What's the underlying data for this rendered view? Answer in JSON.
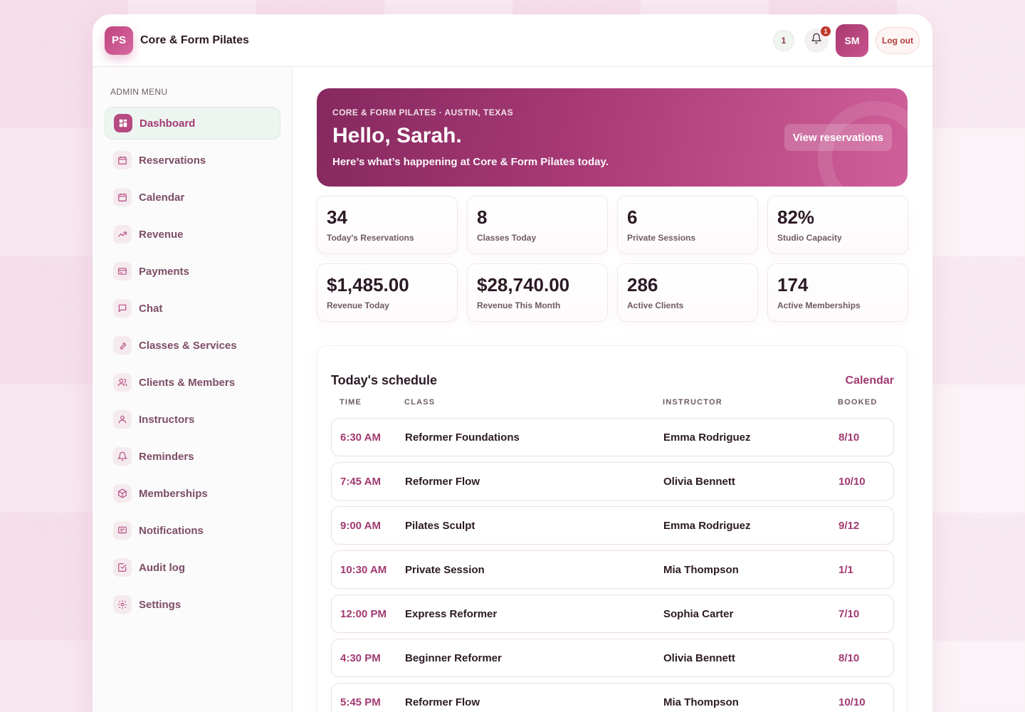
{
  "brand": {
    "initials": "PS",
    "name": "Core & Form Pilates"
  },
  "topbar": {
    "count_pill": "1",
    "bell_badge": "1",
    "avatar_initials": "SM",
    "logout_label": "Log out"
  },
  "sidebar": {
    "title": "ADMIN MENU",
    "items": [
      {
        "label": "Dashboard",
        "icon": "dashboard-icon",
        "active": true
      },
      {
        "label": "Reservations",
        "icon": "calendar-icon"
      },
      {
        "label": "Calendar",
        "icon": "calendar-icon"
      },
      {
        "label": "Revenue",
        "icon": "trend-icon"
      },
      {
        "label": "Payments",
        "icon": "card-icon"
      },
      {
        "label": "Chat",
        "icon": "chat-icon"
      },
      {
        "label": "Classes & Services",
        "icon": "wrench-icon"
      },
      {
        "label": "Clients & Members",
        "icon": "users-icon"
      },
      {
        "label": "Instructors",
        "icon": "user-icon"
      },
      {
        "label": "Reminders",
        "icon": "bell-icon"
      },
      {
        "label": "Memberships",
        "icon": "box-icon"
      },
      {
        "label": "Notifications",
        "icon": "message-icon"
      },
      {
        "label": "Audit log",
        "icon": "check-square-icon"
      },
      {
        "label": "Settings",
        "icon": "gear-icon"
      }
    ]
  },
  "hero": {
    "kicker": "CORE & FORM PILATES · AUSTIN, TEXAS",
    "title": "Hello, Sarah.",
    "subtitle": "Here’s what’s happening at Core & Form Pilates today.",
    "button_label": "View reservations"
  },
  "stats": [
    {
      "value": "34",
      "label": "Today's Reservations"
    },
    {
      "value": "8",
      "label": "Classes Today"
    },
    {
      "value": "6",
      "label": "Private Sessions"
    },
    {
      "value": "82%",
      "label": "Studio Capacity"
    },
    {
      "value": "$1,485.00",
      "label": "Revenue Today"
    },
    {
      "value": "$28,740.00",
      "label": "Revenue This Month"
    },
    {
      "value": "286",
      "label": "Active Clients"
    },
    {
      "value": "174",
      "label": "Active Memberships"
    }
  ],
  "schedule": {
    "title": "Today's schedule",
    "link_label": "Calendar",
    "columns": {
      "time": "TIME",
      "class": "CLASS",
      "instructor": "INSTRUCTOR",
      "booked": "BOOKED"
    },
    "rows": [
      {
        "time": "6:30 AM",
        "class": "Reformer Foundations",
        "instructor": "Emma Rodriguez",
        "booked": "8/10"
      },
      {
        "time": "7:45 AM",
        "class": "Reformer Flow",
        "instructor": "Olivia Bennett",
        "booked": "10/10"
      },
      {
        "time": "9:00 AM",
        "class": "Pilates Sculpt",
        "instructor": "Emma Rodriguez",
        "booked": "9/12"
      },
      {
        "time": "10:30 AM",
        "class": "Private Session",
        "instructor": "Mia Thompson",
        "booked": "1/1"
      },
      {
        "time": "12:00 PM",
        "class": "Express Reformer",
        "instructor": "Sophia Carter",
        "booked": "7/10"
      },
      {
        "time": "4:30 PM",
        "class": "Beginner Reformer",
        "instructor": "Olivia Bennett",
        "booked": "8/10"
      },
      {
        "time": "5:45 PM",
        "class": "Reformer Flow",
        "instructor": "Mia Thompson",
        "booked": "10/10"
      }
    ]
  },
  "colors": {
    "accent": "#a13a72",
    "hero_start": "#86285f",
    "hero_end": "#cf5f9a",
    "alert": "#c0392b"
  }
}
